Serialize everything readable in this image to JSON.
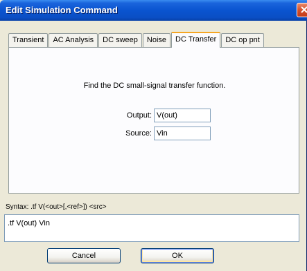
{
  "window": {
    "title": "Edit Simulation Command"
  },
  "tabs": [
    {
      "label": "Transient",
      "active": false
    },
    {
      "label": "AC Analysis",
      "active": false
    },
    {
      "label": "DC sweep",
      "active": false
    },
    {
      "label": "Noise",
      "active": false
    },
    {
      "label": "DC Transfer",
      "active": true
    },
    {
      "label": "DC op pnt",
      "active": false
    }
  ],
  "panel": {
    "description": "Find the DC small-signal transfer function.",
    "output_label": "Output:",
    "output_value": "V(out)",
    "source_label": "Source:",
    "source_value": "Vin"
  },
  "syntax": "Syntax:  .tf V(<out>[,<ref>]) <src>",
  "command": ".tf V(out) Vin",
  "buttons": {
    "cancel_label": "Cancel",
    "ok_label": "OK"
  },
  "colors": {
    "title_bar": "#0a54d0",
    "active_tab_accent": "#f5a623",
    "close_button": "#d4502c"
  }
}
